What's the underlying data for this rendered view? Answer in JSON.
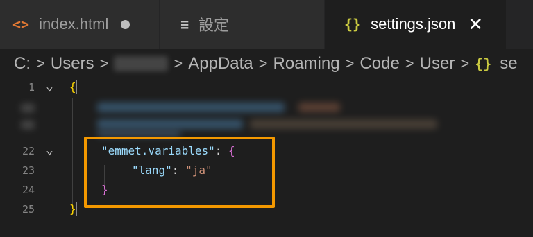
{
  "tabs": [
    {
      "icon": "<>",
      "label": "index.html"
    },
    {
      "icon": "≡",
      "label": "設定"
    },
    {
      "icon": "{}",
      "label": "settings.json"
    }
  ],
  "breadcrumb": {
    "drive": "C:",
    "users": "Users",
    "appdata": "AppData",
    "roaming": "Roaming",
    "code": "Code",
    "user": "User",
    "json_icon": "{}",
    "file_partial": "se"
  },
  "editor": {
    "line1": {
      "num": "1",
      "text": "{"
    },
    "line22": {
      "num": "22",
      "key": "\"emmet.variables\"",
      "colon": ": ",
      "brace": "{"
    },
    "line23": {
      "num": "23",
      "key": "\"lang\"",
      "colon": ": ",
      "value": "\"ja\""
    },
    "line24": {
      "num": "24",
      "brace": "}"
    },
    "line25": {
      "num": "25",
      "brace": "}"
    }
  },
  "colors": {
    "highlight": "#f39800",
    "key": "#9cdcfe",
    "string": "#ce9178",
    "brace_gold": "#ffd700",
    "brace_pink": "#da70d6"
  }
}
